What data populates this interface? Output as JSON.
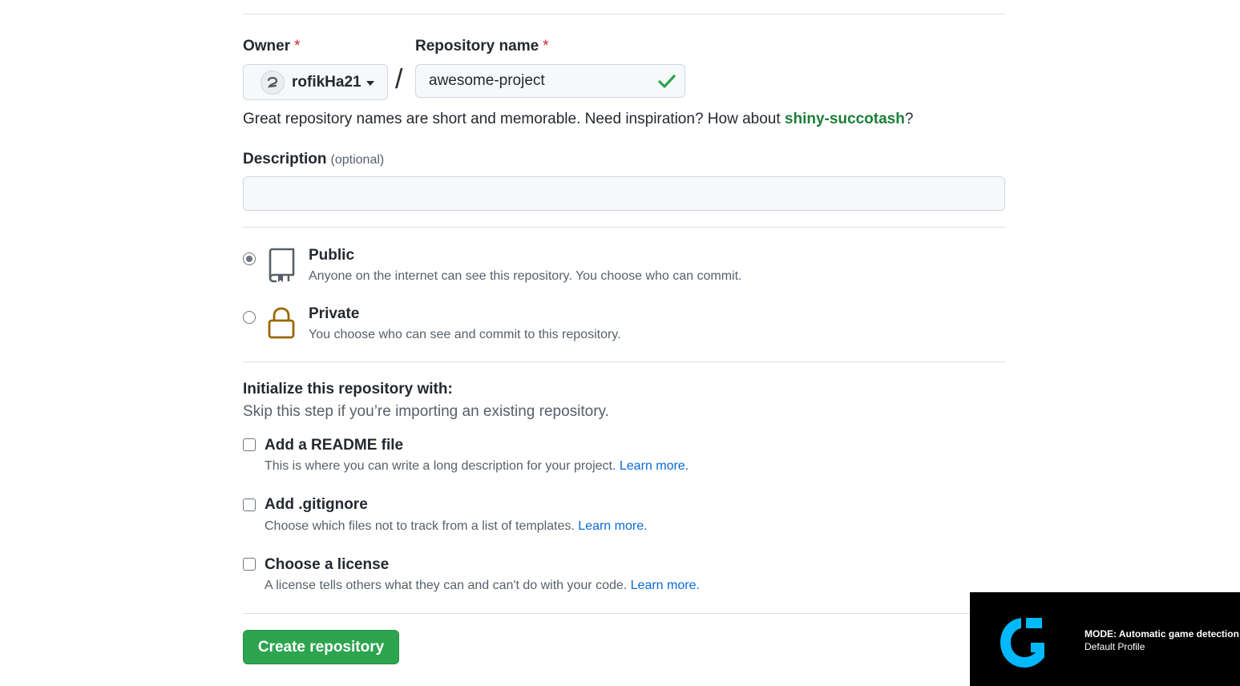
{
  "owner": {
    "label": "Owner",
    "required_mark": "*",
    "selected": "rofikHa21"
  },
  "repo": {
    "label": "Repository name",
    "required_mark": "*",
    "value": "awesome-project",
    "separator": "/"
  },
  "hint": {
    "text": "Great repository names are short and memorable. Need inspiration? How about ",
    "suggestion": "shiny-succotash",
    "suffix": "?"
  },
  "description": {
    "label": "Description",
    "optional": "(optional)",
    "value": ""
  },
  "visibility": {
    "public": {
      "title": "Public",
      "desc": "Anyone on the internet can see this repository. You choose who can commit.",
      "checked": true
    },
    "private": {
      "title": "Private",
      "desc": "You choose who can see and commit to this repository.",
      "checked": false
    }
  },
  "init": {
    "title": "Initialize this repository with:",
    "subtitle": "Skip this step if you’re importing an existing repository.",
    "readme": {
      "title": "Add a README file",
      "desc": "This is where you can write a long description for your project. ",
      "link": "Learn more."
    },
    "gitignore": {
      "title": "Add .gitignore",
      "desc": "Choose which files not to track from a list of templates. ",
      "link": "Learn more."
    },
    "license": {
      "title": "Choose a license",
      "desc": "A license tells others what they can and can't do with your code. ",
      "link": "Learn more."
    }
  },
  "create_button": "Create repository",
  "overlay": {
    "mode": "MODE: Automatic game detection",
    "profile": "Default Profile"
  },
  "colors": {
    "accent_green": "#2da44e",
    "link_blue": "#0969da",
    "suggestion_green": "#1a7f37",
    "required_red": "#cf222e",
    "lock_gold": "#9a6700",
    "logitech_blue": "#00b8fc"
  }
}
